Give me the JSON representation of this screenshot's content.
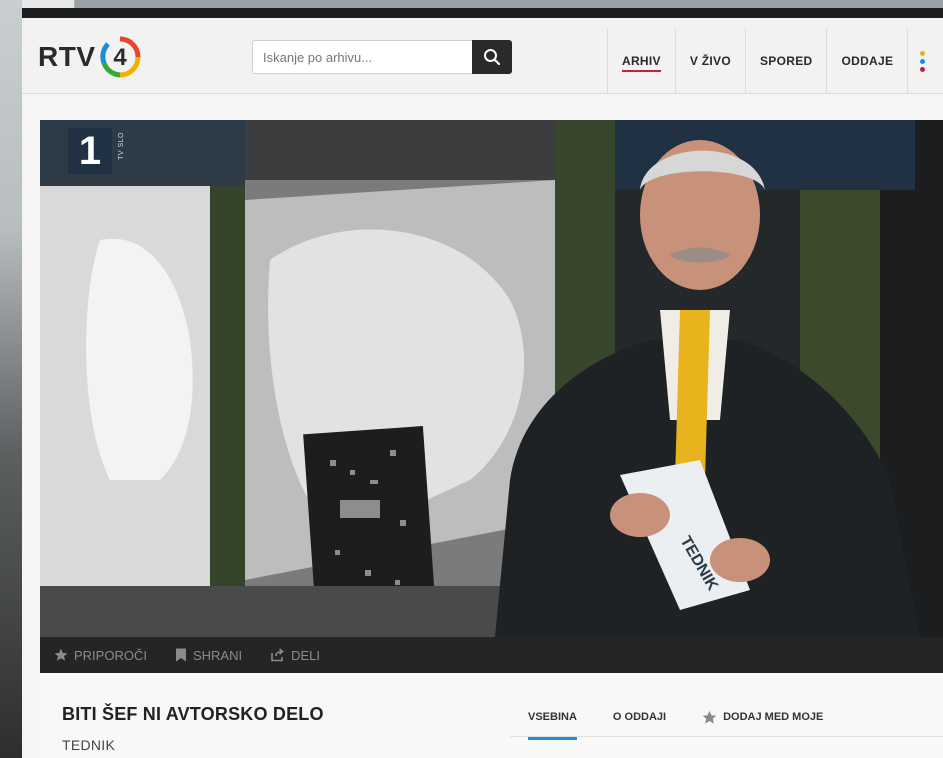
{
  "site": {
    "logo_text": "RTV",
    "logo_number": "4"
  },
  "search": {
    "placeholder": "Iskanje po arhivu..."
  },
  "nav": {
    "items": [
      {
        "label": "ARHIV",
        "active": true
      },
      {
        "label": "V ŽIVO",
        "active": false
      },
      {
        "label": "SPORED",
        "active": false
      },
      {
        "label": "ODDAJE",
        "active": false
      }
    ],
    "more_dot_colors": [
      "#e8b31c",
      "#1b8fd6",
      "#c4213a"
    ]
  },
  "video": {
    "channel_number": "1",
    "channel_sub": "TV SLO",
    "paper_text": "TEDNIK"
  },
  "video_actions": [
    {
      "label": "PRIPOROČI",
      "icon": "star-icon"
    },
    {
      "label": "SHRANI",
      "icon": "bookmark-icon"
    },
    {
      "label": "DELI",
      "icon": "share-icon"
    }
  ],
  "episode": {
    "title": "BITI ŠEF NI AVTORSKO DELO",
    "show": "TEDNIK"
  },
  "tabs": [
    {
      "label": "VSEBINA",
      "active": true
    },
    {
      "label": "O ODDAJI",
      "active": false
    },
    {
      "label": "DODAJ MED MOJE",
      "active": false,
      "icon": "star-icon"
    }
  ],
  "colors": {
    "accent_red": "#c4213a",
    "accent_blue": "#1b8fd6",
    "tie_yellow": "#e8b31c"
  }
}
